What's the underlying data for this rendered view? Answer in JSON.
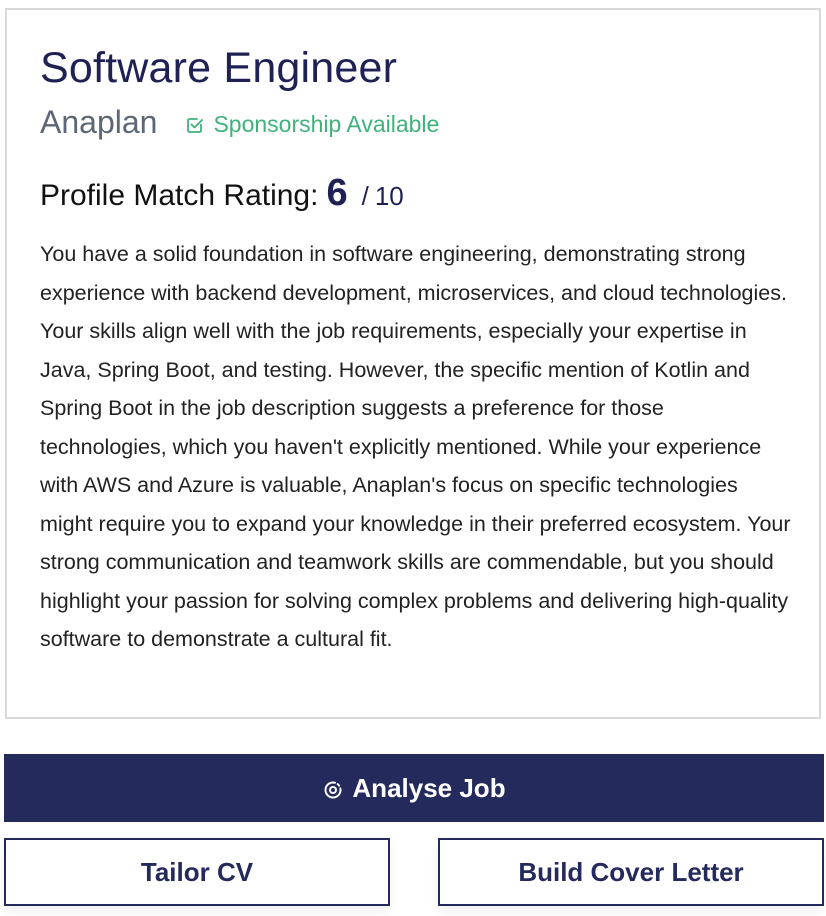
{
  "job": {
    "title": "Software Engineer",
    "company": "Anaplan",
    "sponsorship": "Sponsorship Available"
  },
  "rating": {
    "label": "Profile Match Rating:",
    "score": "6",
    "separator": "/",
    "max": "10"
  },
  "summary": "You have a solid foundation in software engineering, demonstrating strong experience with backend development, microservices, and cloud technologies. Your skills align well with the job requirements, especially your expertise in Java, Spring Boot, and testing. However, the specific mention of Kotlin and Spring Boot in the job description suggests a preference for those technologies, which you haven't explicitly mentioned. While your experience with AWS and Azure is valuable, Anaplan's focus on specific technologies might require you to expand your knowledge in their preferred ecosystem. Your strong communication and teamwork skills are commendable, but you should highlight your passion for solving complex problems and delivering high-quality software to demonstrate a cultural fit.",
  "actions": {
    "analyse_label": "Analyse Job",
    "analyse_icon": "target-scan-icon",
    "tailor_label": "Tailor CV",
    "cover_label": "Build Cover Letter"
  },
  "colors": {
    "primary": "#252a5c",
    "title": "#1f2154",
    "sponsor": "#3fb27a",
    "company": "#5e6677"
  }
}
